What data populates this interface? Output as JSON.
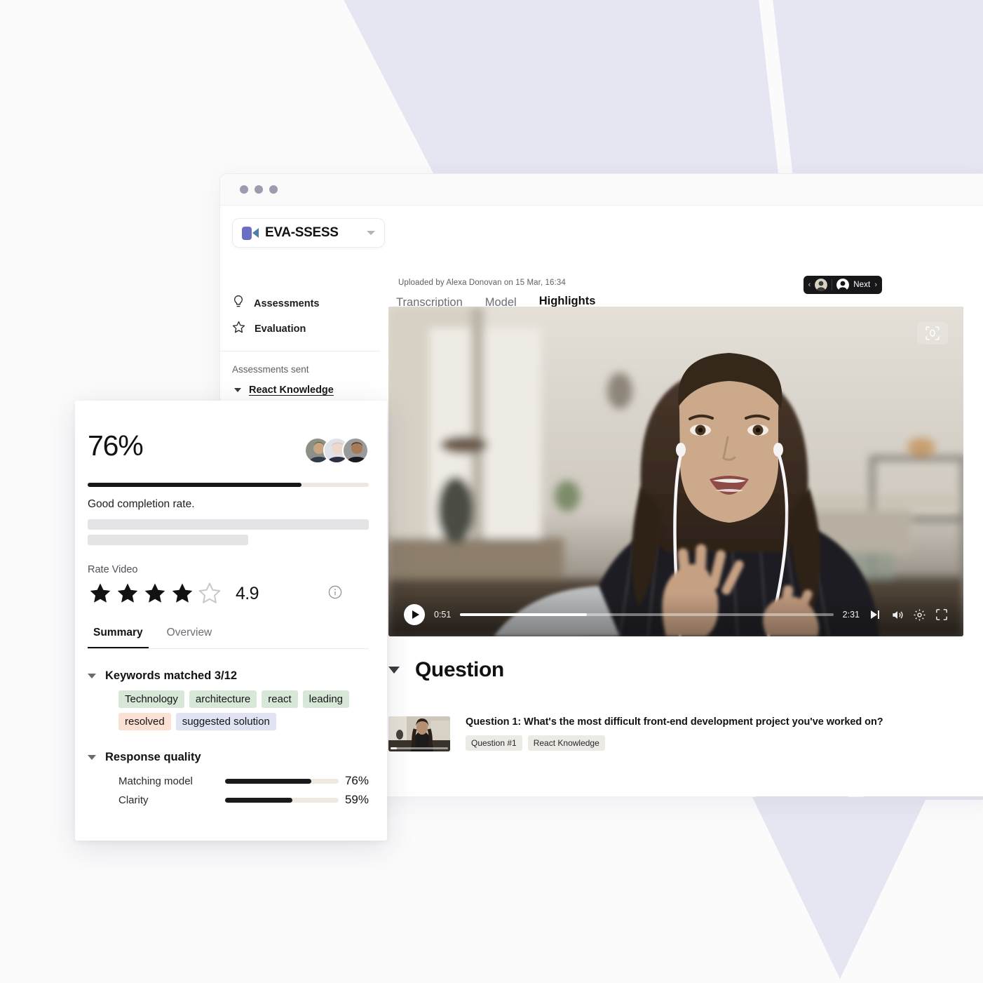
{
  "background": {
    "page_color": "#fbfbfc",
    "chevron_color": "#e6e6f2"
  },
  "window": {
    "traffic_lights": [
      "dot-1",
      "dot-2",
      "dot-3"
    ]
  },
  "header": {
    "logo_text": "EVA-SSESS",
    "logo_caret_icon": "chevron-down-icon",
    "uploaded_meta": "Uploaded by Alexa Donovan on 15 Mar, 16:34",
    "tabs": [
      {
        "label": "Transcription",
        "active": false
      },
      {
        "label": "Model",
        "active": false
      },
      {
        "label": "Highlights",
        "active": true
      }
    ],
    "nav": {
      "prev_icon": "chevron-left-icon",
      "next_icon": "chevron-right-icon",
      "next_label": "Next"
    }
  },
  "sidebar": {
    "items": [
      {
        "label": "Assessments",
        "icon": "lightbulb-icon"
      },
      {
        "label": "Evaluation",
        "icon": "star-outline-icon"
      }
    ],
    "section_label": "Assessments sent",
    "assessments": [
      {
        "label": "React Knowledge",
        "icon": "caret-down-icon"
      }
    ]
  },
  "video": {
    "scan_icon": "face-scan-icon",
    "play_icon": "play-icon",
    "current_time": "0:51",
    "duration": "2:31",
    "progress_percent": 34,
    "controls": [
      {
        "name": "next-track-icon"
      },
      {
        "name": "volume-icon"
      },
      {
        "name": "settings-gear-icon"
      },
      {
        "name": "fullscreen-icon"
      }
    ]
  },
  "question_section": {
    "caret_icon": "caret-down-icon",
    "title": "Question",
    "items": [
      {
        "text": "Question 1: What's the most difficult front-end development project you've worked on?",
        "tags": [
          "Question #1",
          "React Knowledge"
        ]
      }
    ]
  },
  "summary_card": {
    "percent": "76%",
    "progress_percent": 76,
    "caption": "Good completion rate.",
    "avatar_count": 3,
    "rate_label": "Rate Video",
    "stars_filled": 4,
    "stars_total": 5,
    "score": "4.9",
    "info_icon": "info-circle-icon",
    "tabs": [
      {
        "label": "Summary",
        "active": true
      },
      {
        "label": "Overview",
        "active": false
      }
    ],
    "keywords": {
      "title": "Keywords matched 3/12",
      "caret_icon": "caret-down-icon",
      "chips": [
        {
          "label": "Technology",
          "color": "#d8e8d8"
        },
        {
          "label": "architecture",
          "color": "#d8e8d8"
        },
        {
          "label": "react",
          "color": "#d8e8d8"
        },
        {
          "label": "leading",
          "color": "#d8e8d8"
        },
        {
          "label": "resolved",
          "color": "#fbe1d4"
        },
        {
          "label": "suggested solution",
          "color": "#dfe3f2"
        }
      ]
    },
    "response_quality": {
      "title": "Response quality",
      "caret_icon": "caret-down-icon",
      "rows": [
        {
          "name": "Matching model",
          "value": "76%",
          "percent": 76
        },
        {
          "name": "Clarity",
          "value": "59%",
          "percent": 59
        }
      ]
    }
  }
}
